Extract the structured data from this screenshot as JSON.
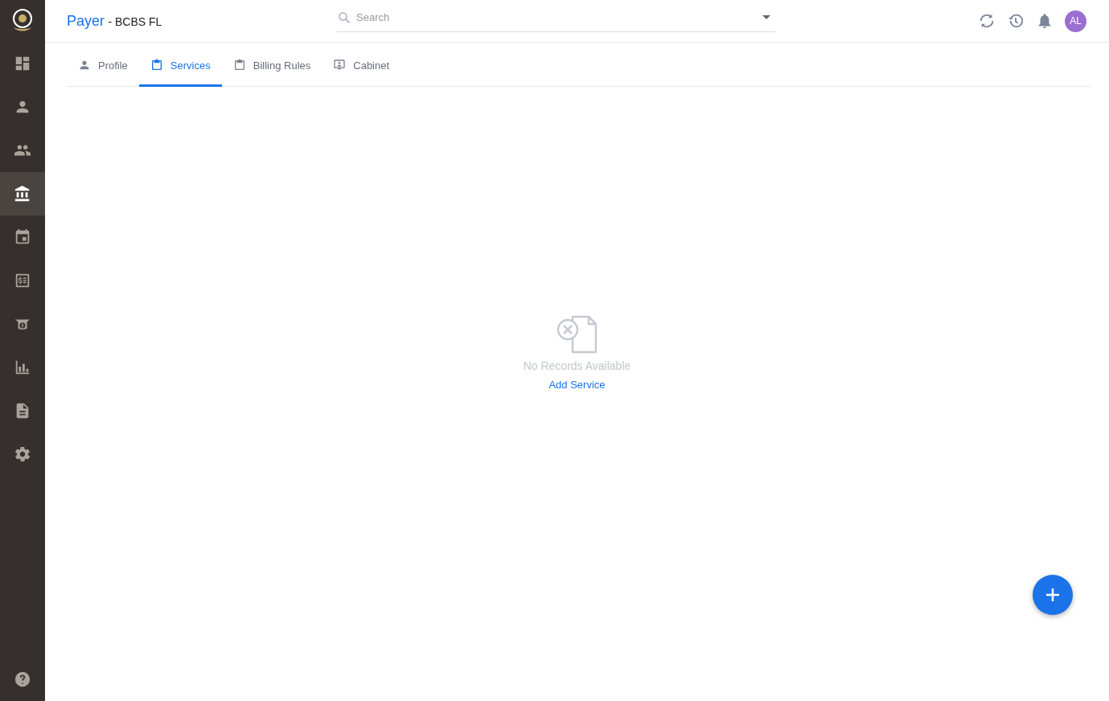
{
  "sidebar": {
    "items": [
      {
        "kind": "dashboard",
        "selected": false
      },
      {
        "kind": "person",
        "selected": false
      },
      {
        "kind": "people",
        "selected": false
      },
      {
        "kind": "bank",
        "selected": true
      },
      {
        "kind": "calendar",
        "selected": false
      },
      {
        "kind": "invoice",
        "selected": false
      },
      {
        "kind": "money",
        "selected": false
      },
      {
        "kind": "chart",
        "selected": false
      },
      {
        "kind": "document",
        "selected": false
      },
      {
        "kind": "settings",
        "selected": false
      }
    ]
  },
  "header": {
    "title": "Payer",
    "subtitle": "- BCBS FL",
    "search": {
      "placeholder": "Search"
    },
    "avatar": "AL"
  },
  "tabs": [
    {
      "label": "Profile",
      "kind": "person",
      "selected": false
    },
    {
      "label": "Services",
      "kind": "clipboard",
      "selected": true
    },
    {
      "label": "Billing Rules",
      "kind": "clipboard",
      "selected": false
    },
    {
      "label": "Cabinet",
      "kind": "cabinet",
      "selected": false
    }
  ],
  "empty_state": {
    "message": "No Records Available",
    "action": "Add Service"
  }
}
